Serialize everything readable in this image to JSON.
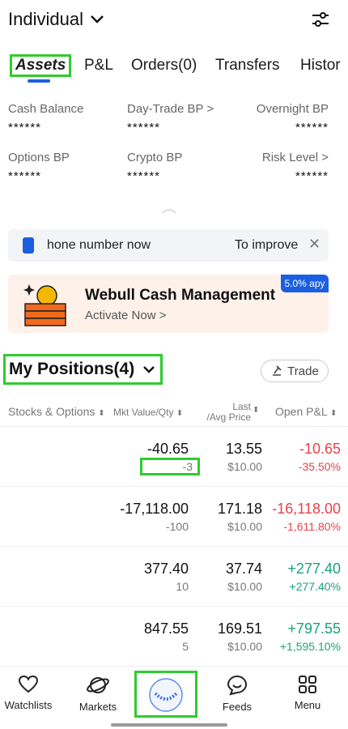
{
  "header": {
    "account": "Individual"
  },
  "tabs": [
    "Assets",
    "P&L",
    "Orders(0)",
    "Transfers",
    "Histor"
  ],
  "stats": [
    {
      "label": "Cash Balance",
      "value": "******"
    },
    {
      "label": "Day-Trade BP >",
      "value": "******"
    },
    {
      "label": "Overnight BP",
      "value": "******"
    },
    {
      "label": "Options BP",
      "value": "******"
    },
    {
      "label": "Crypto BP",
      "value": "******"
    },
    {
      "label": "Risk Level >",
      "value": "******"
    }
  ],
  "notice": {
    "text_left": "hone number now",
    "text_right": "To improve"
  },
  "promo": {
    "title": "Webull Cash Management",
    "subtitle": "Activate Now >",
    "badge": "5.0% apy"
  },
  "positions": {
    "title": "My Positions(4)",
    "trade_label": "Trade",
    "columns": [
      "Stocks & Options",
      "Mkt Value/Qty",
      "Last",
      "/Avg Price",
      "Open P&L"
    ],
    "rows": [
      {
        "mkt": "-40.65",
        "qty": "-3",
        "last": "13.55",
        "avg": "$10.00",
        "pl": "-10.65",
        "plpct": "-35.50%",
        "dir": "down"
      },
      {
        "mkt": "-17,118.00",
        "qty": "-100",
        "last": "171.18",
        "avg": "$10.00",
        "pl": "-16,118.00",
        "plpct": "-1,611.80%",
        "dir": "down"
      },
      {
        "mkt": "377.40",
        "qty": "10",
        "last": "37.74",
        "avg": "$10.00",
        "pl": "+277.40",
        "plpct": "+277.40%",
        "dir": "up"
      },
      {
        "mkt": "847.55",
        "qty": "5",
        "last": "169.51",
        "avg": "$10.00",
        "pl": "+797.55",
        "plpct": "+1,595.10%",
        "dir": "up"
      }
    ]
  },
  "nav": {
    "watchlists": "Watchlists",
    "markets": "Markets",
    "feeds": "Feeds",
    "menu": "Menu"
  },
  "colors": {
    "accent": "#1b5fe0",
    "loss": "#e8424b",
    "gain": "#1aa37a",
    "highlight": "#2ecc2e"
  }
}
